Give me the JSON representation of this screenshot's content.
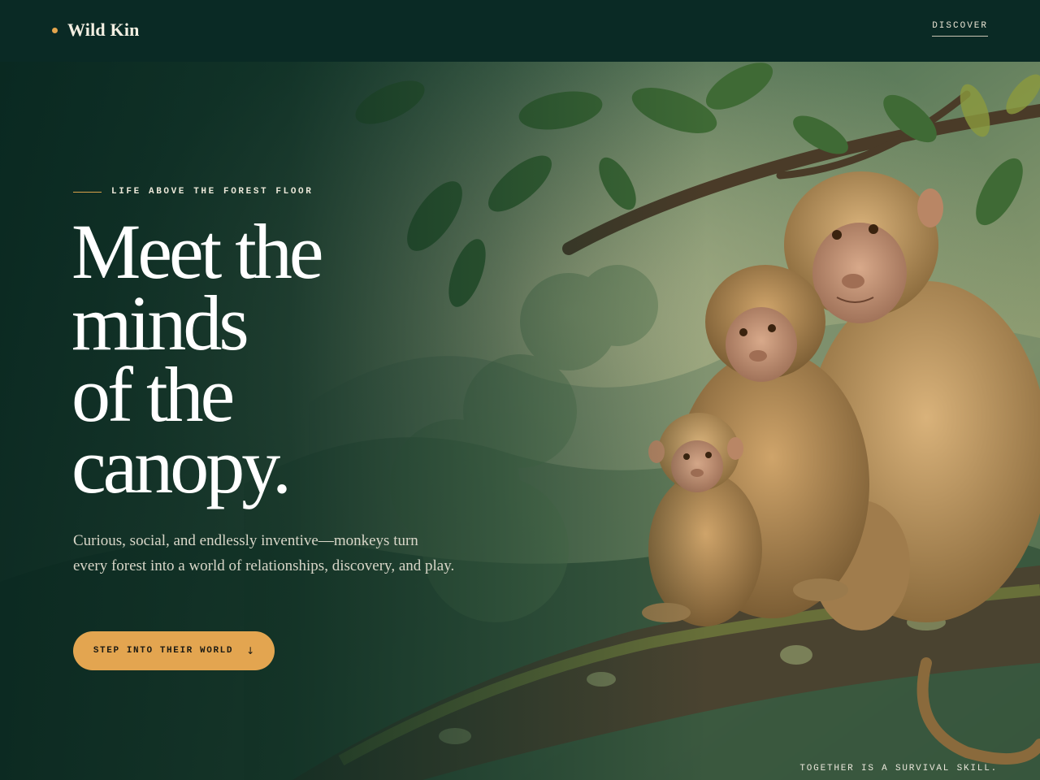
{
  "header": {
    "brand_name": "Wild Kin",
    "nav_discover": "DISCOVER"
  },
  "hero": {
    "eyebrow": "LIFE ABOVE THE FOREST FLOOR",
    "headline_lines": [
      "Meet the",
      "minds",
      "of the",
      "canopy."
    ],
    "lede": "Curious, social, and endlessly inventive—monkeys turn every forest into a world of relationships, discovery, and play.",
    "cta_label": "STEP INTO THEIR WORLD",
    "cta_icon": "arrow-down-icon",
    "caption": "TOGETHER IS A SURVIVAL SKILL."
  },
  "colors": {
    "header_bg": "#0a2a25",
    "accent": "#e3a550",
    "headline": "#ffffff",
    "body_text": "#d8d6c8"
  }
}
